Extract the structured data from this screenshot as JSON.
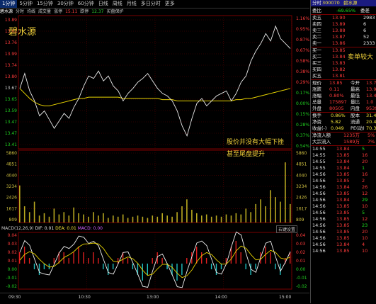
{
  "timeframe_tabs": [
    "1分钟",
    "5分钟",
    "15分钟",
    "30分钟",
    "60分钟",
    "日线",
    "周线",
    "月线",
    "多日分时",
    "更多"
  ],
  "info_line": {
    "name": "碧水源",
    "items": [
      "分时",
      "均线",
      "成交量",
      "涨停",
      "15.11",
      "跌停",
      "12.37",
      "买盘保护"
    ]
  },
  "stock_overlay_name": "碧水源",
  "price_axis_left": [
    "14.00",
    "13.88",
    "13.76",
    "13.74",
    "13.52",
    "13.39",
    "13.27",
    "13.15",
    "13.03",
    "12.91",
    "12.79",
    "12.67"
  ],
  "price_axis_left_main": [
    "13.89",
    "13.62",
    "13.76",
    "13.99",
    "13.74",
    "13.80",
    "13.67",
    "13.65",
    "13.59",
    "13.47",
    "13.47",
    "13.41"
  ],
  "pct_axis_right": [
    "1.16%",
    "0.95%",
    "0.87%",
    "0.67%",
    "0.58%",
    "0.38%",
    "0.29%",
    "0.17%",
    "0.00%",
    "0.15%",
    "0.28%",
    "0.37%",
    "0.54%"
  ],
  "volume_axis_left": [
    "5860",
    "4851",
    "4040",
    "3234",
    "2426",
    "1617",
    "809"
  ],
  "volume_axis_right": [
    "5860",
    "4851",
    "4040",
    "3234",
    "2426",
    "1617",
    "809"
  ],
  "macd_header": {
    "title": "MACD(12,26,9)",
    "dif": "DIF: 0.01",
    "dea": "DEA: 0.01",
    "macd": "MACD: 0.00",
    "jump": "右键设置"
  },
  "macd_axis": [
    "0.04",
    "0.03",
    "0.02",
    "0.01",
    "0.00",
    "-0.01",
    "-0.02"
  ],
  "time_axis": [
    "09:30",
    "10:30",
    "13:00",
    "14:00",
    "15:00"
  ],
  "annotation": {
    "line1": "股价并没有大幅下挫",
    "line2": "甚至尾盘提升"
  },
  "chart_data": {
    "type": "line",
    "series": [
      {
        "values": [
          13.5,
          13.62,
          13.48,
          13.4,
          13.28,
          13.32,
          13.25,
          13.18,
          13.24,
          13.3,
          13.26,
          13.35,
          13.42,
          13.52,
          13.6,
          13.58,
          13.64,
          13.56,
          13.6,
          13.52,
          13.48,
          13.4,
          13.46,
          13.5,
          13.55,
          13.58,
          13.62,
          13.56,
          13.5,
          13.46,
          13.44,
          13.4,
          13.32,
          13.2,
          13.12,
          13.26,
          13.38,
          13.42,
          13.36,
          13.4,
          13.44,
          13.46,
          13.48,
          13.4,
          13.46,
          13.55,
          13.6,
          13.72,
          13.8,
          13.86,
          13.94,
          13.88,
          14.0,
          13.9,
          13.86,
          13.82
        ]
      },
      {
        "values": [
          13.5,
          13.46,
          13.42,
          13.39,
          13.37,
          13.36,
          13.36,
          13.37,
          13.38,
          13.39,
          13.4,
          13.41,
          13.42,
          13.42,
          13.43,
          13.43,
          13.43,
          13.43,
          13.43,
          13.43,
          13.43,
          13.42,
          13.42,
          13.42,
          13.42,
          13.42,
          13.42,
          13.42,
          13.42,
          13.41,
          13.41,
          13.41,
          13.4,
          13.4,
          13.4,
          13.4,
          13.4,
          13.4,
          13.4,
          13.4,
          13.4,
          13.4,
          13.4,
          13.4,
          13.41,
          13.41,
          13.42,
          13.42,
          13.43,
          13.44,
          13.45,
          13.46,
          13.47,
          13.48,
          13.49,
          13.5
        ]
      }
    ],
    "volume": [
      3.2,
      1.4,
      0.9,
      1.8,
      0.6,
      0.8,
      0.5,
      1.2,
      0.7,
      0.9,
      0.6,
      1.3,
      0.8,
      0.7,
      0.5,
      0.9,
      0.6,
      0.8,
      0.4,
      0.6,
      0.5,
      0.7,
      0.4,
      0.5,
      0.6,
      0.5,
      0.4,
      0.6,
      0.5,
      0.8,
      0.6,
      0.5,
      0.9,
      1.4,
      2.0,
      1.1,
      0.8,
      0.6,
      0.7,
      0.5,
      0.6,
      0.5,
      0.7,
      0.6,
      0.8,
      0.7,
      1.2,
      0.9,
      1.6,
      2.0,
      1.4,
      2.8,
      2.2,
      1.8,
      5.2,
      1.6
    ],
    "macd_hist": [
      0.02,
      0.03,
      0.01,
      -0.01,
      -0.02,
      -0.01,
      -0.01,
      0.01,
      0.02,
      0.02,
      0.01,
      0.02,
      0.03,
      0.02,
      0.01,
      0.02,
      0.01,
      -0.01,
      -0.02,
      -0.01,
      0.01,
      0.02,
      0.01,
      -0.01,
      -0.02,
      -0.03,
      -0.02,
      0.01,
      0.02,
      0.01,
      -0.01,
      -0.02,
      -0.03,
      -0.02,
      0.01,
      0.02,
      0.03,
      0.02,
      0.01,
      -0.01,
      -0.02,
      -0.01,
      0.01,
      0.03,
      0.04,
      0.02,
      -0.01,
      -0.02,
      -0.01,
      0.02,
      0.03,
      0.02,
      -0.01,
      -0.02,
      0.01,
      0.02
    ]
  },
  "panel": {
    "top_tabs": [
      "分时",
      "↓",
      "自选"
    ],
    "code": "300070",
    "name": "碧水源",
    "weibi": {
      "label": "委比",
      "value": "-69.65%",
      "right": "委差"
    },
    "asks": [
      {
        "label": "卖五",
        "price": "13.90",
        "vol": "2983"
      },
      {
        "label": "卖四",
        "price": "13.89",
        "vol": "6"
      },
      {
        "label": "卖三",
        "price": "13.88",
        "vol": "6"
      },
      {
        "label": "卖二",
        "price": "13.87",
        "vol": "52"
      },
      {
        "label": "卖一",
        "price": "13.86",
        "vol": "2333"
      }
    ],
    "bids": [
      {
        "label": "买一",
        "price": "13.85",
        "vol": ""
      },
      {
        "label": "买二",
        "price": "13.84",
        "vol": ""
      },
      {
        "label": "买三",
        "price": "13.83",
        "vol": ""
      },
      {
        "label": "买四",
        "price": "13.82",
        "vol": ""
      },
      {
        "label": "买五",
        "price": "13.81",
        "vol": ""
      }
    ],
    "ask_note": "卖单较大",
    "quotes": [
      {
        "l1": "现价",
        "v1": "13.85",
        "l2": "今开",
        "v2": "13.7"
      },
      {
        "l1": "涨跌",
        "v1": "0.11",
        "l2": "最高",
        "v2": "13.9"
      },
      {
        "l1": "涨幅",
        "v1": "0.80%",
        "l2": "最低",
        "v2": "13.4"
      },
      {
        "l1": "总量",
        "v1": "175897",
        "l2": "量比",
        "v2": "1.0"
      },
      {
        "l1": "外盘",
        "v1": "80505",
        "l2": "内盘",
        "v2": "9539"
      }
    ],
    "stats": [
      {
        "l1": "换手",
        "v1": "0.86%",
        "l2": "股本",
        "v2": "31.4"
      },
      {
        "l1": "净资",
        "v1": "5.82",
        "l2": "流通",
        "v2": "20.4"
      },
      {
        "l1": "收益(-)",
        "v1": "0.049",
        "l2": "PE(动)",
        "v2": "70.3"
      }
    ],
    "flows": [
      {
        "l": "净流入额",
        "v": "1235万",
        "p": "5%"
      },
      {
        "l": "大宗流入",
        "v": "1589万",
        "p": "7%"
      }
    ],
    "ticks": [
      {
        "t": "14:55",
        "p": "13.84",
        "v": "5"
      },
      {
        "t": "14:55",
        "p": "13.85",
        "v": "16"
      },
      {
        "t": "14:55",
        "p": "13.84",
        "v": "20"
      },
      {
        "t": "14:55",
        "p": "13.84",
        "v": "1"
      },
      {
        "t": "14:56",
        "p": "13.85",
        "v": "16"
      },
      {
        "t": "14:56",
        "p": "13.85",
        "v": "2"
      },
      {
        "t": "14:56",
        "p": "13.84",
        "v": "26"
      },
      {
        "t": "14:56",
        "p": "13.85",
        "v": "12"
      },
      {
        "t": "14:56",
        "p": "13.84",
        "v": "29"
      },
      {
        "t": "14:56",
        "p": "13.85",
        "v": "10"
      },
      {
        "t": "14:56",
        "p": "13.85",
        "v": "5"
      },
      {
        "t": "14:56",
        "p": "13.85",
        "v": "12"
      },
      {
        "t": "14:56",
        "p": "13.85",
        "v": "23"
      },
      {
        "t": "14:56",
        "p": "13.85",
        "v": "20"
      },
      {
        "t": "14:56",
        "p": "13.85",
        "v": "10"
      },
      {
        "t": "14:56",
        "p": "13.84",
        "v": "4"
      },
      {
        "t": "14:56",
        "p": "13.85",
        "v": "10"
      }
    ]
  }
}
